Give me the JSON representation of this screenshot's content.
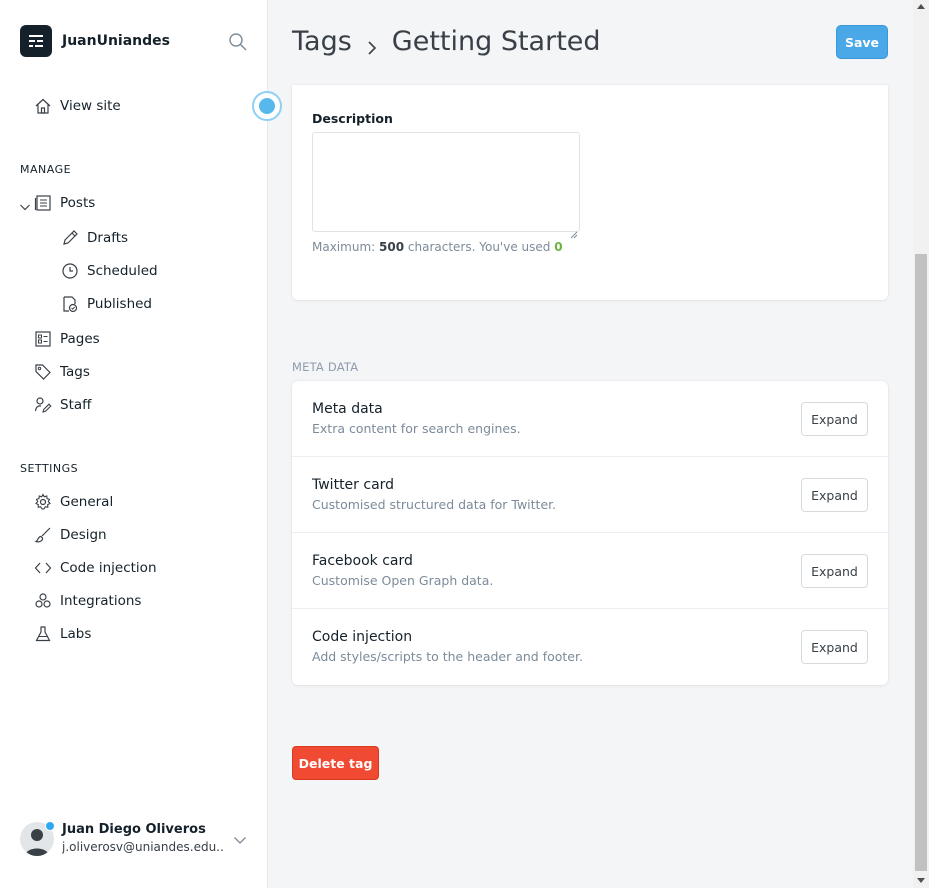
{
  "brand": {
    "name": "JuanUniandes"
  },
  "nav": {
    "view_site": "View site",
    "manage_label": "MANAGE",
    "posts": "Posts",
    "drafts": "Drafts",
    "scheduled": "Scheduled",
    "published": "Published",
    "pages": "Pages",
    "tags": "Tags",
    "staff": "Staff",
    "settings_label": "SETTINGS",
    "general": "General",
    "design": "Design",
    "code_injection": "Code injection",
    "integrations": "Integrations",
    "labs": "Labs"
  },
  "user": {
    "name": "Juan Diego Oliveros",
    "email": "j.oliverosv@uniandes.edu...."
  },
  "header": {
    "crumb_parent": "Tags",
    "crumb_current": "Getting Started",
    "save_label": "Save"
  },
  "description": {
    "label": "Description",
    "value": "",
    "hint_prefix": "Maximum:",
    "max": "500",
    "hint_middle": "characters. You've used",
    "used": "0"
  },
  "meta": {
    "heading": "META DATA",
    "rows": [
      {
        "title": "Meta data",
        "subtitle": "Extra content for search engines.",
        "button": "Expand"
      },
      {
        "title": "Twitter card",
        "subtitle": "Customised structured data for Twitter.",
        "button": "Expand"
      },
      {
        "title": "Facebook card",
        "subtitle": "Customise Open Graph data.",
        "button": "Expand"
      },
      {
        "title": "Code injection",
        "subtitle": "Add styles/scripts to the header and footer.",
        "button": "Expand"
      }
    ]
  },
  "delete_label": "Delete tag",
  "colors": {
    "save": "#4aa8e8",
    "delete": "#f04a32",
    "used_count": "#6cb33f",
    "pulse": "#56b8ec"
  },
  "icons": [
    "ghost-logo-icon",
    "search-icon",
    "home-icon",
    "posts-icon",
    "pencil-icon",
    "clock-icon",
    "published-icon",
    "pages-icon",
    "tag-icon",
    "staff-icon",
    "gear-icon",
    "brush-icon",
    "code-icon",
    "integrations-icon",
    "flask-icon",
    "chevron-down-icon",
    "chevron-right-icon"
  ]
}
